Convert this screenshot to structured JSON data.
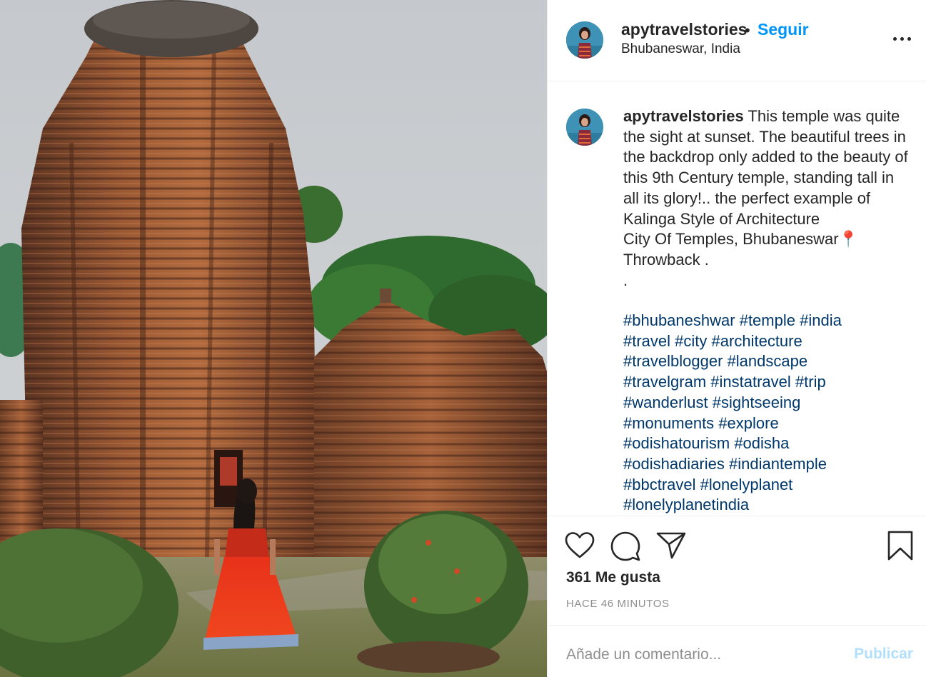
{
  "header": {
    "username": "apytravelstories",
    "separator": "•",
    "follow_label": "Seguir",
    "location": "Bhubaneswar, India"
  },
  "caption": {
    "username": "apytravelstories",
    "text": " This temple was quite the sight at sunset. The beautiful trees in the backdrop only added to the beauty of this 9th Century temple, standing tall in all its glory!.. the perfect example of Kalinga Style of Architecture\nCity Of Temples, Bhubaneswar📍\nThrowback .\n.",
    "hashtag_lines": [
      [
        "#bhubaneshwar",
        "#temple",
        "#india"
      ],
      [
        "#travel",
        "#city",
        "#architecture"
      ],
      [
        "#travelblogger",
        "#landscape"
      ],
      [
        "#travelgram",
        "#instatravel",
        "#trip"
      ],
      [
        "#wanderlust",
        "#sightseeing"
      ],
      [
        "#monuments",
        "#explore"
      ],
      [
        "#odishatourism",
        "#odisha"
      ],
      [
        "#odishadiaries",
        "#indiantemple"
      ],
      [
        "#bbctravel",
        "#lonelyplanet"
      ],
      [
        "#lonelyplanetindia"
      ]
    ]
  },
  "actions": {
    "icons": [
      "heart-icon",
      "comment-icon",
      "share-icon",
      "bookmark-icon"
    ],
    "likes": "361 Me gusta",
    "timestamp": "HACE 46 MINUTOS"
  },
  "comment": {
    "placeholder": "Añade un comentario...",
    "publish_label": "Publicar"
  },
  "colors": {
    "link": "#0095f6",
    "hashtag": "#00376b",
    "muted": "#8e8e8e",
    "publish_disabled": "#b2dffc"
  }
}
